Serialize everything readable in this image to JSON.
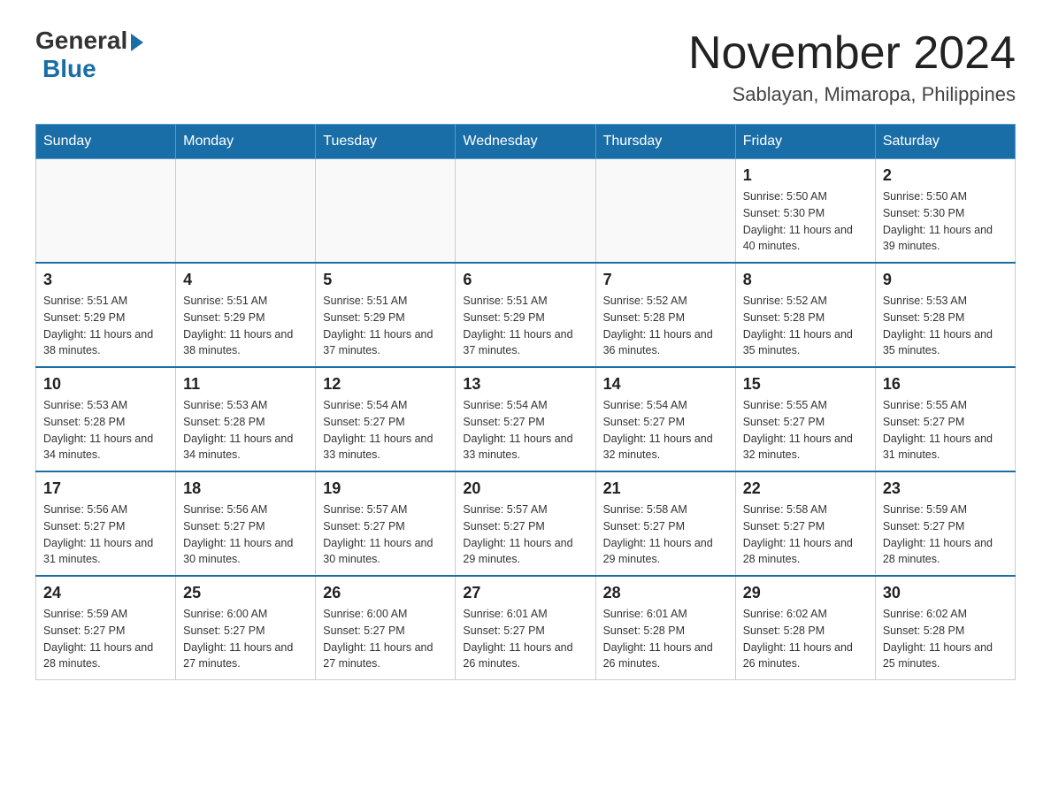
{
  "header": {
    "logo_general": "General",
    "logo_blue": "Blue",
    "month_title": "November 2024",
    "location": "Sablayan, Mimaropa, Philippines"
  },
  "weekdays": [
    "Sunday",
    "Monday",
    "Tuesday",
    "Wednesday",
    "Thursday",
    "Friday",
    "Saturday"
  ],
  "weeks": [
    [
      {
        "day": "",
        "sunrise": "",
        "sunset": "",
        "daylight": ""
      },
      {
        "day": "",
        "sunrise": "",
        "sunset": "",
        "daylight": ""
      },
      {
        "day": "",
        "sunrise": "",
        "sunset": "",
        "daylight": ""
      },
      {
        "day": "",
        "sunrise": "",
        "sunset": "",
        "daylight": ""
      },
      {
        "day": "",
        "sunrise": "",
        "sunset": "",
        "daylight": ""
      },
      {
        "day": "1",
        "sunrise": "Sunrise: 5:50 AM",
        "sunset": "Sunset: 5:30 PM",
        "daylight": "Daylight: 11 hours and 40 minutes."
      },
      {
        "day": "2",
        "sunrise": "Sunrise: 5:50 AM",
        "sunset": "Sunset: 5:30 PM",
        "daylight": "Daylight: 11 hours and 39 minutes."
      }
    ],
    [
      {
        "day": "3",
        "sunrise": "Sunrise: 5:51 AM",
        "sunset": "Sunset: 5:29 PM",
        "daylight": "Daylight: 11 hours and 38 minutes."
      },
      {
        "day": "4",
        "sunrise": "Sunrise: 5:51 AM",
        "sunset": "Sunset: 5:29 PM",
        "daylight": "Daylight: 11 hours and 38 minutes."
      },
      {
        "day": "5",
        "sunrise": "Sunrise: 5:51 AM",
        "sunset": "Sunset: 5:29 PM",
        "daylight": "Daylight: 11 hours and 37 minutes."
      },
      {
        "day": "6",
        "sunrise": "Sunrise: 5:51 AM",
        "sunset": "Sunset: 5:29 PM",
        "daylight": "Daylight: 11 hours and 37 minutes."
      },
      {
        "day": "7",
        "sunrise": "Sunrise: 5:52 AM",
        "sunset": "Sunset: 5:28 PM",
        "daylight": "Daylight: 11 hours and 36 minutes."
      },
      {
        "day": "8",
        "sunrise": "Sunrise: 5:52 AM",
        "sunset": "Sunset: 5:28 PM",
        "daylight": "Daylight: 11 hours and 35 minutes."
      },
      {
        "day": "9",
        "sunrise": "Sunrise: 5:53 AM",
        "sunset": "Sunset: 5:28 PM",
        "daylight": "Daylight: 11 hours and 35 minutes."
      }
    ],
    [
      {
        "day": "10",
        "sunrise": "Sunrise: 5:53 AM",
        "sunset": "Sunset: 5:28 PM",
        "daylight": "Daylight: 11 hours and 34 minutes."
      },
      {
        "day": "11",
        "sunrise": "Sunrise: 5:53 AM",
        "sunset": "Sunset: 5:28 PM",
        "daylight": "Daylight: 11 hours and 34 minutes."
      },
      {
        "day": "12",
        "sunrise": "Sunrise: 5:54 AM",
        "sunset": "Sunset: 5:27 PM",
        "daylight": "Daylight: 11 hours and 33 minutes."
      },
      {
        "day": "13",
        "sunrise": "Sunrise: 5:54 AM",
        "sunset": "Sunset: 5:27 PM",
        "daylight": "Daylight: 11 hours and 33 minutes."
      },
      {
        "day": "14",
        "sunrise": "Sunrise: 5:54 AM",
        "sunset": "Sunset: 5:27 PM",
        "daylight": "Daylight: 11 hours and 32 minutes."
      },
      {
        "day": "15",
        "sunrise": "Sunrise: 5:55 AM",
        "sunset": "Sunset: 5:27 PM",
        "daylight": "Daylight: 11 hours and 32 minutes."
      },
      {
        "day": "16",
        "sunrise": "Sunrise: 5:55 AM",
        "sunset": "Sunset: 5:27 PM",
        "daylight": "Daylight: 11 hours and 31 minutes."
      }
    ],
    [
      {
        "day": "17",
        "sunrise": "Sunrise: 5:56 AM",
        "sunset": "Sunset: 5:27 PM",
        "daylight": "Daylight: 11 hours and 31 minutes."
      },
      {
        "day": "18",
        "sunrise": "Sunrise: 5:56 AM",
        "sunset": "Sunset: 5:27 PM",
        "daylight": "Daylight: 11 hours and 30 minutes."
      },
      {
        "day": "19",
        "sunrise": "Sunrise: 5:57 AM",
        "sunset": "Sunset: 5:27 PM",
        "daylight": "Daylight: 11 hours and 30 minutes."
      },
      {
        "day": "20",
        "sunrise": "Sunrise: 5:57 AM",
        "sunset": "Sunset: 5:27 PM",
        "daylight": "Daylight: 11 hours and 29 minutes."
      },
      {
        "day": "21",
        "sunrise": "Sunrise: 5:58 AM",
        "sunset": "Sunset: 5:27 PM",
        "daylight": "Daylight: 11 hours and 29 minutes."
      },
      {
        "day": "22",
        "sunrise": "Sunrise: 5:58 AM",
        "sunset": "Sunset: 5:27 PM",
        "daylight": "Daylight: 11 hours and 28 minutes."
      },
      {
        "day": "23",
        "sunrise": "Sunrise: 5:59 AM",
        "sunset": "Sunset: 5:27 PM",
        "daylight": "Daylight: 11 hours and 28 minutes."
      }
    ],
    [
      {
        "day": "24",
        "sunrise": "Sunrise: 5:59 AM",
        "sunset": "Sunset: 5:27 PM",
        "daylight": "Daylight: 11 hours and 28 minutes."
      },
      {
        "day": "25",
        "sunrise": "Sunrise: 6:00 AM",
        "sunset": "Sunset: 5:27 PM",
        "daylight": "Daylight: 11 hours and 27 minutes."
      },
      {
        "day": "26",
        "sunrise": "Sunrise: 6:00 AM",
        "sunset": "Sunset: 5:27 PM",
        "daylight": "Daylight: 11 hours and 27 minutes."
      },
      {
        "day": "27",
        "sunrise": "Sunrise: 6:01 AM",
        "sunset": "Sunset: 5:27 PM",
        "daylight": "Daylight: 11 hours and 26 minutes."
      },
      {
        "day": "28",
        "sunrise": "Sunrise: 6:01 AM",
        "sunset": "Sunset: 5:28 PM",
        "daylight": "Daylight: 11 hours and 26 minutes."
      },
      {
        "day": "29",
        "sunrise": "Sunrise: 6:02 AM",
        "sunset": "Sunset: 5:28 PM",
        "daylight": "Daylight: 11 hours and 26 minutes."
      },
      {
        "day": "30",
        "sunrise": "Sunrise: 6:02 AM",
        "sunset": "Sunset: 5:28 PM",
        "daylight": "Daylight: 11 hours and 25 minutes."
      }
    ]
  ]
}
